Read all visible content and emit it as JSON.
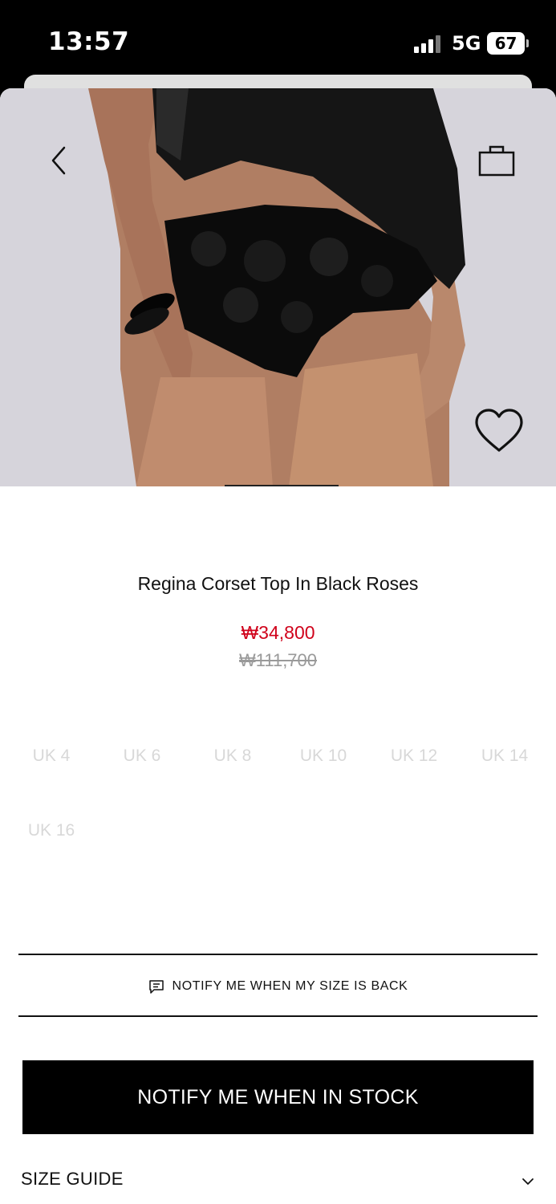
{
  "status_bar": {
    "time": "13:57",
    "network": "5G",
    "battery": "67"
  },
  "product": {
    "title": "Regina Corset Top In Black Roses",
    "price": "₩34,800",
    "original_price": "₩111,700"
  },
  "sizes": [
    "UK 4",
    "UK 6",
    "UK 8",
    "UK 10",
    "UK 12",
    "UK 14",
    "UK 16"
  ],
  "actions": {
    "notify_size_label": "NOTIFY ME WHEN MY SIZE IS BACK",
    "notify_stock_label": "NOTIFY ME WHEN IN STOCK",
    "size_guide_label": "SIZE GUIDE"
  },
  "icons": {
    "back": "chevron-left-icon",
    "bag": "shopping-bag-icon",
    "wishlist": "heart-icon",
    "message": "message-icon",
    "expand": "chevron-down-icon"
  },
  "colors": {
    "sale_price": "#d0021b",
    "accent": "#000000",
    "hero_background": "#d6d4db"
  }
}
